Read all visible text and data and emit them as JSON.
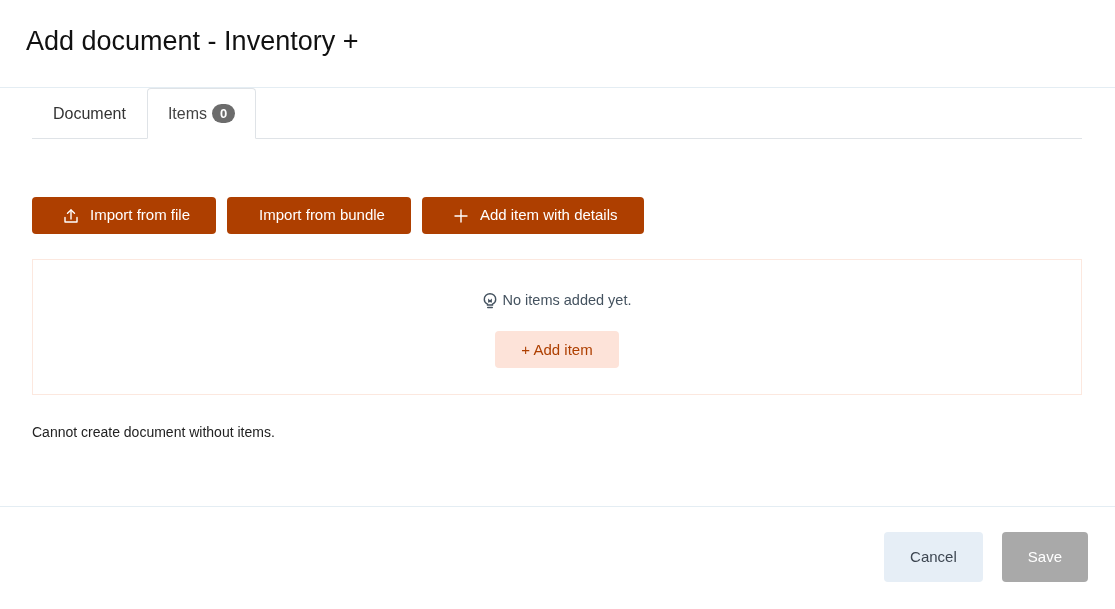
{
  "window": {
    "title": "Add document - Inventory +"
  },
  "tabs": [
    {
      "label": "Document",
      "selected": false
    },
    {
      "label": "Items",
      "selected": true,
      "count": "0"
    }
  ],
  "toolbar": [
    {
      "kind": "upload",
      "label": "Import from file"
    },
    {
      "kind": "text",
      "label": "Import from bundle"
    },
    {
      "kind": "add",
      "label": "Add item with details"
    }
  ],
  "empty_state": {
    "message": "No items added yet.",
    "button": "+ Add item"
  },
  "validation_message": "Cannot create document without items.",
  "footer_buttons": [
    {
      "kind": "secondary",
      "label": "Cancel",
      "disabled": false
    },
    {
      "kind": "primary",
      "label": "Save",
      "disabled": true
    }
  ]
}
